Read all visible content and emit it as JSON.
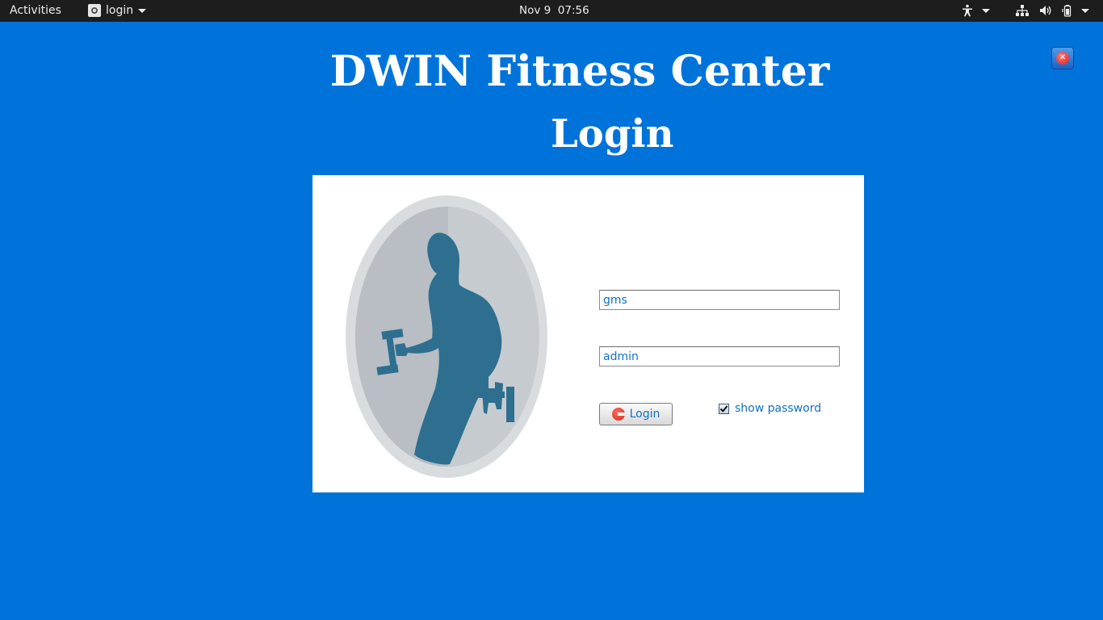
{
  "topbar": {
    "activities_label": "Activities",
    "app_menu_label": "login",
    "clock": "Nov 9  07:56",
    "tray_icons": [
      "accessibility-icon",
      "network-icon",
      "volume-icon",
      "battery-icon",
      "system-menu-caret-icon"
    ]
  },
  "window": {
    "title": "DWIN Fitness Center",
    "subtitle": "Login",
    "close_icon": "close-icon"
  },
  "form": {
    "username_value": "gms",
    "password_value": "admin",
    "login_button_label": "Login",
    "show_password_label": "show password",
    "show_password_checked": true
  },
  "colors": {
    "background": "#0073da",
    "panel": "#ffffff",
    "text_accent": "#1270c4",
    "logo_silhouette": "#2e6f8f"
  }
}
